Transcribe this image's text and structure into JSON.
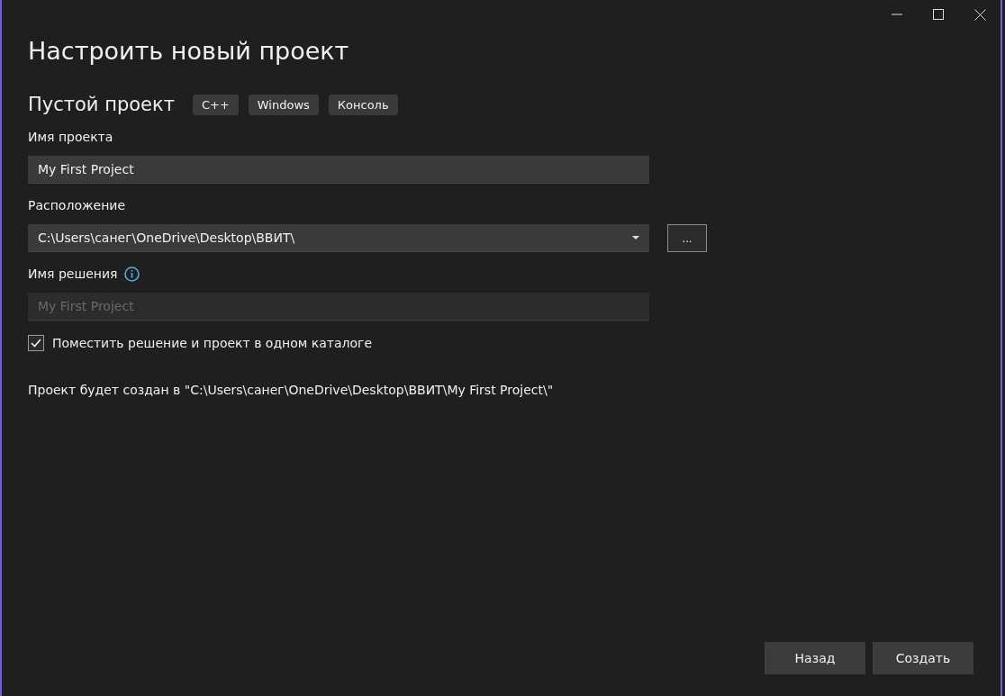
{
  "window": {
    "title": "Настроить новый проект"
  },
  "template": {
    "name": "Пустой проект",
    "tags": [
      "C++",
      "Windows",
      "Консоль"
    ]
  },
  "fields": [
    {
      "kind": "text",
      "label": "Имя проекта",
      "value": "My First Project",
      "disabled": false,
      "has_info": false
    },
    {
      "kind": "dropdown",
      "label": "Расположение",
      "value": "C:\\Users\\санег\\OneDrive\\Desktop\\ВВИТ\\",
      "browse_button": "...",
      "disabled": false,
      "has_info": false
    },
    {
      "kind": "text",
      "label": "Имя решения",
      "value": "My First Project",
      "disabled": true,
      "has_info": true
    }
  ],
  "checkbox": {
    "label": "Поместить решение и проект в одном каталоге",
    "checked": true
  },
  "summary": "Проект будет создан в \"C:\\Users\\санег\\OneDrive\\Desktop\\ВВИТ\\My First Project\\\"",
  "buttons": [
    {
      "label": "Назад"
    },
    {
      "label": "Создать"
    }
  ]
}
